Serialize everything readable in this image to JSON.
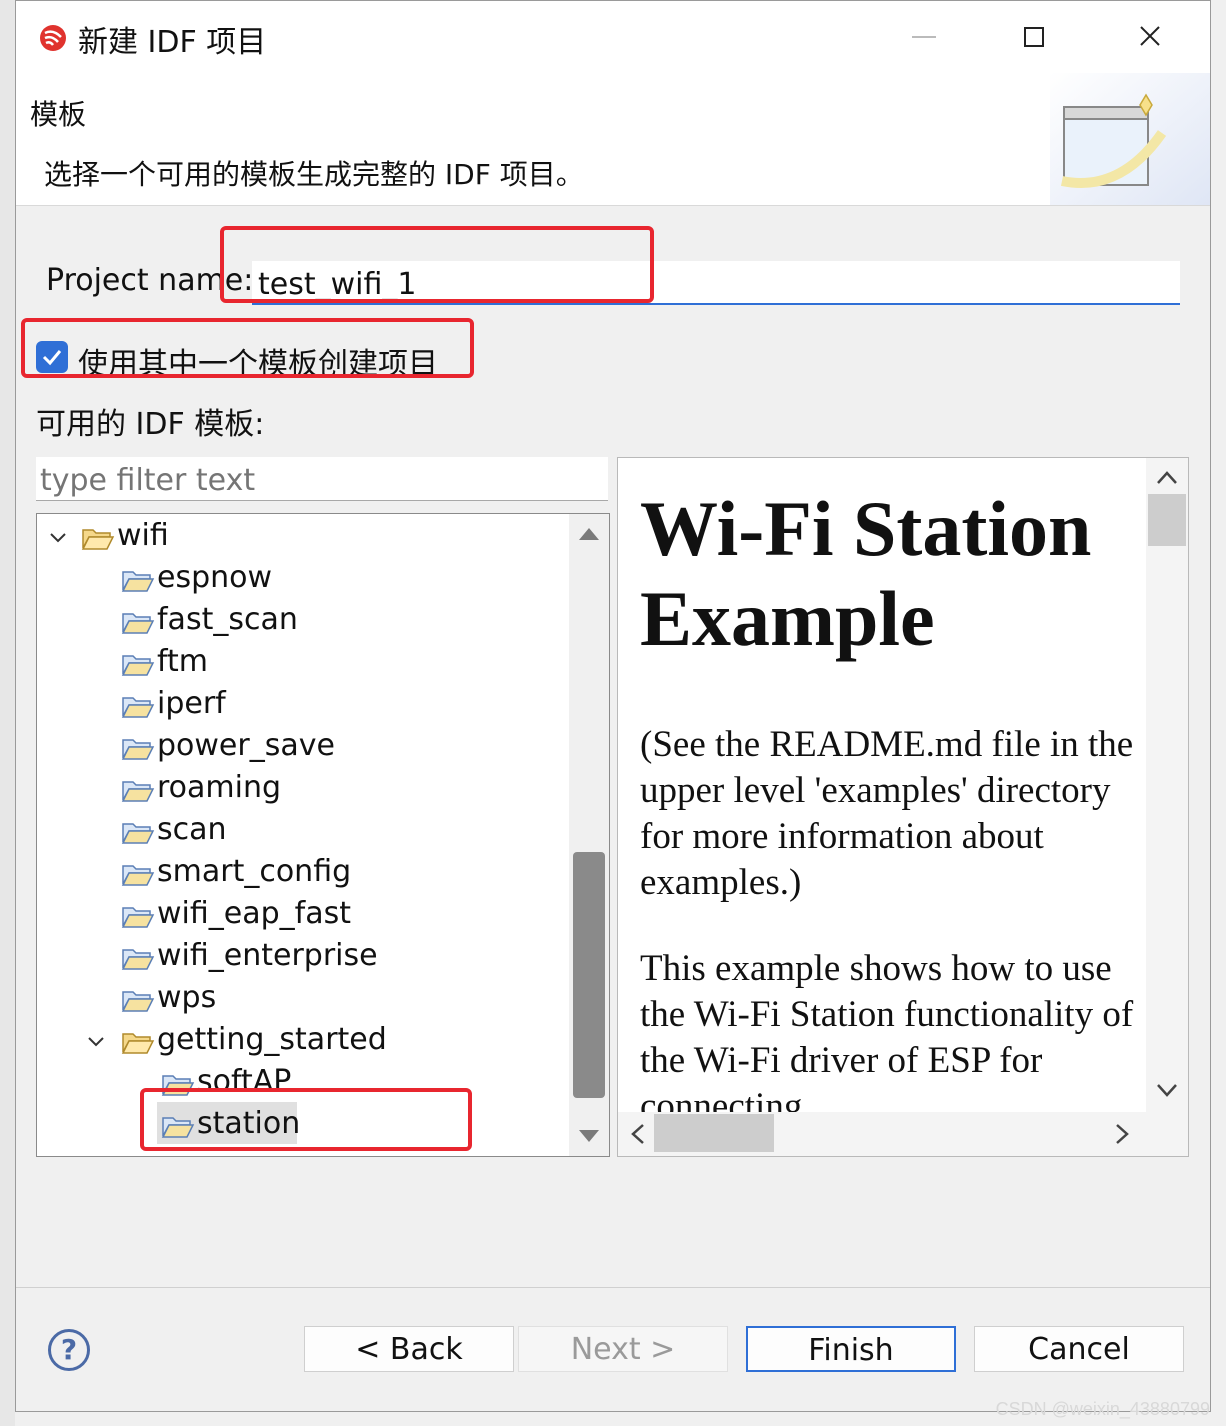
{
  "window": {
    "title": "新建 IDF 项目"
  },
  "header": {
    "title": "模板",
    "description": "选择一个可用的模板生成完整的 IDF 项目。"
  },
  "form": {
    "project_name_label": "Project name:",
    "project_name_value": "test_wifi_1",
    "use_template_label": "使用其中一个模板创建项目",
    "use_template_checked": true,
    "available_label": "可用的 IDF 模板:",
    "filter_placeholder": "type filter text"
  },
  "tree": {
    "root": "wifi",
    "children": [
      "espnow",
      "fast_scan",
      "ftm",
      "iperf",
      "power_save",
      "roaming",
      "scan",
      "smart_config",
      "wifi_eap_fast",
      "wifi_enterprise",
      "wps"
    ],
    "group": "getting_started",
    "group_children": [
      "softAP",
      "station"
    ],
    "selected": "station"
  },
  "preview": {
    "heading": "Wi-Fi Station Example",
    "paragraph1": "(See the README.md file in the upper level 'examples' directory for more information about examples.)",
    "paragraph2": "This example shows how to use the Wi-Fi Station functionality of the Wi-Fi driver of ESP for connecting"
  },
  "buttons": {
    "back": "< Back",
    "next": "Next >",
    "finish": "Finish",
    "cancel": "Cancel",
    "help": "?"
  },
  "watermark": "CSDN @weixin_43880799",
  "colors": {
    "accent": "#2f6fd6",
    "highlight": "#e8262f"
  }
}
